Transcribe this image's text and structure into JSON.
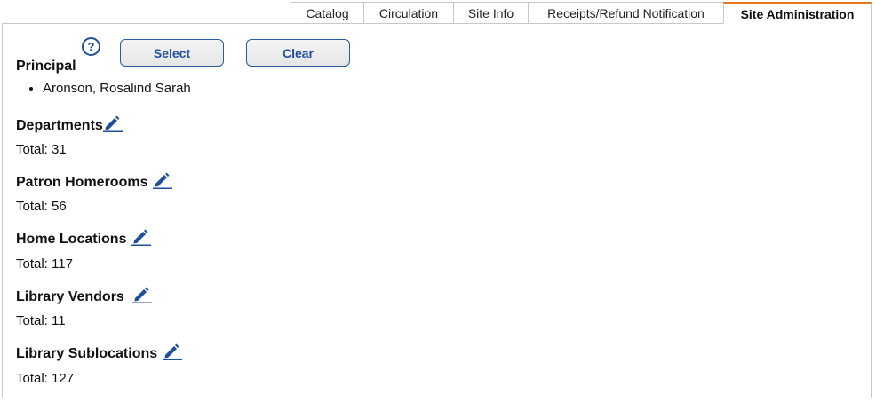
{
  "tabs": [
    {
      "label": "Catalog"
    },
    {
      "label": "Circulation"
    },
    {
      "label": "Site Info"
    },
    {
      "label": "Receipts/Refund Notification"
    },
    {
      "label": "Site Administration"
    }
  ],
  "active_tab": "Site Administration",
  "accent_color": "#e8741e",
  "link_color": "#1f4e9a",
  "principal": {
    "title": "Principal",
    "select_label": "Select",
    "clear_label": "Clear",
    "names": [
      "Aronson, Rosalind Sarah"
    ]
  },
  "sections": [
    {
      "title": "Departments",
      "total": "Total: 31"
    },
    {
      "title": "Patron Homerooms",
      "total": "Total: 56"
    },
    {
      "title": "Home Locations",
      "total": "Total: 117"
    },
    {
      "title": "Library Vendors",
      "total": "Total: 11"
    },
    {
      "title": "Library Sublocations",
      "total": "Total: 127"
    }
  ],
  "icons": {
    "help": "help-circle-icon",
    "edit": "pencil-edit-icon"
  }
}
